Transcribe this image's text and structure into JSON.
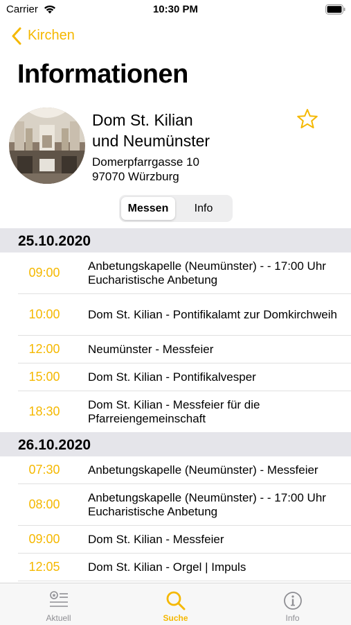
{
  "status_bar": {
    "carrier": "Carrier",
    "time": "10:30 PM"
  },
  "nav": {
    "back_label": "Kirchen"
  },
  "page_title": "Informationen",
  "church": {
    "name_line1": "Dom St. Kilian",
    "name_line2": "und Neumünster",
    "address_line1": "Domerpfarrgasse 10",
    "address_line2": "97070 Würzburg"
  },
  "segments": {
    "selected": "Messen",
    "other": "Info"
  },
  "sections": [
    {
      "date": "25.10.2020",
      "rows": [
        {
          "time": "09:00",
          "text": "Anbetungskapelle (Neumünster) - - 17:00 Uhr Eucharistische Anbetung"
        },
        {
          "time": "10:00",
          "text": "Dom St. Kilian - Pontifikalamt zur Domkirchweih"
        },
        {
          "time": "12:00",
          "text": "Neumünster - Messfeier"
        },
        {
          "time": "15:00",
          "text": "Dom St. Kilian - Pontifikalvesper"
        },
        {
          "time": "18:30",
          "text": "Dom St. Kilian - Messfeier für die Pfarreiengemeinschaft"
        }
      ]
    },
    {
      "date": "26.10.2020",
      "rows": [
        {
          "time": "07:30",
          "text": "Anbetungskapelle (Neumünster) - Messfeier"
        },
        {
          "time": "08:00",
          "text": "Anbetungskapelle (Neumünster) - - 17:00 Uhr Eucharistische Anbetung"
        },
        {
          "time": "09:00",
          "text": "Dom St. Kilian - Messfeier"
        },
        {
          "time": "12:05",
          "text": "Dom St. Kilian - Orgel | Impuls"
        }
      ]
    }
  ],
  "tabs": [
    {
      "label": "Aktuell",
      "icon": "news-list-icon"
    },
    {
      "label": "Suche",
      "icon": "search-icon"
    },
    {
      "label": "Info",
      "icon": "info-icon"
    }
  ],
  "colors": {
    "accent": "#f5b800",
    "section_bg": "#e5e5ea"
  }
}
